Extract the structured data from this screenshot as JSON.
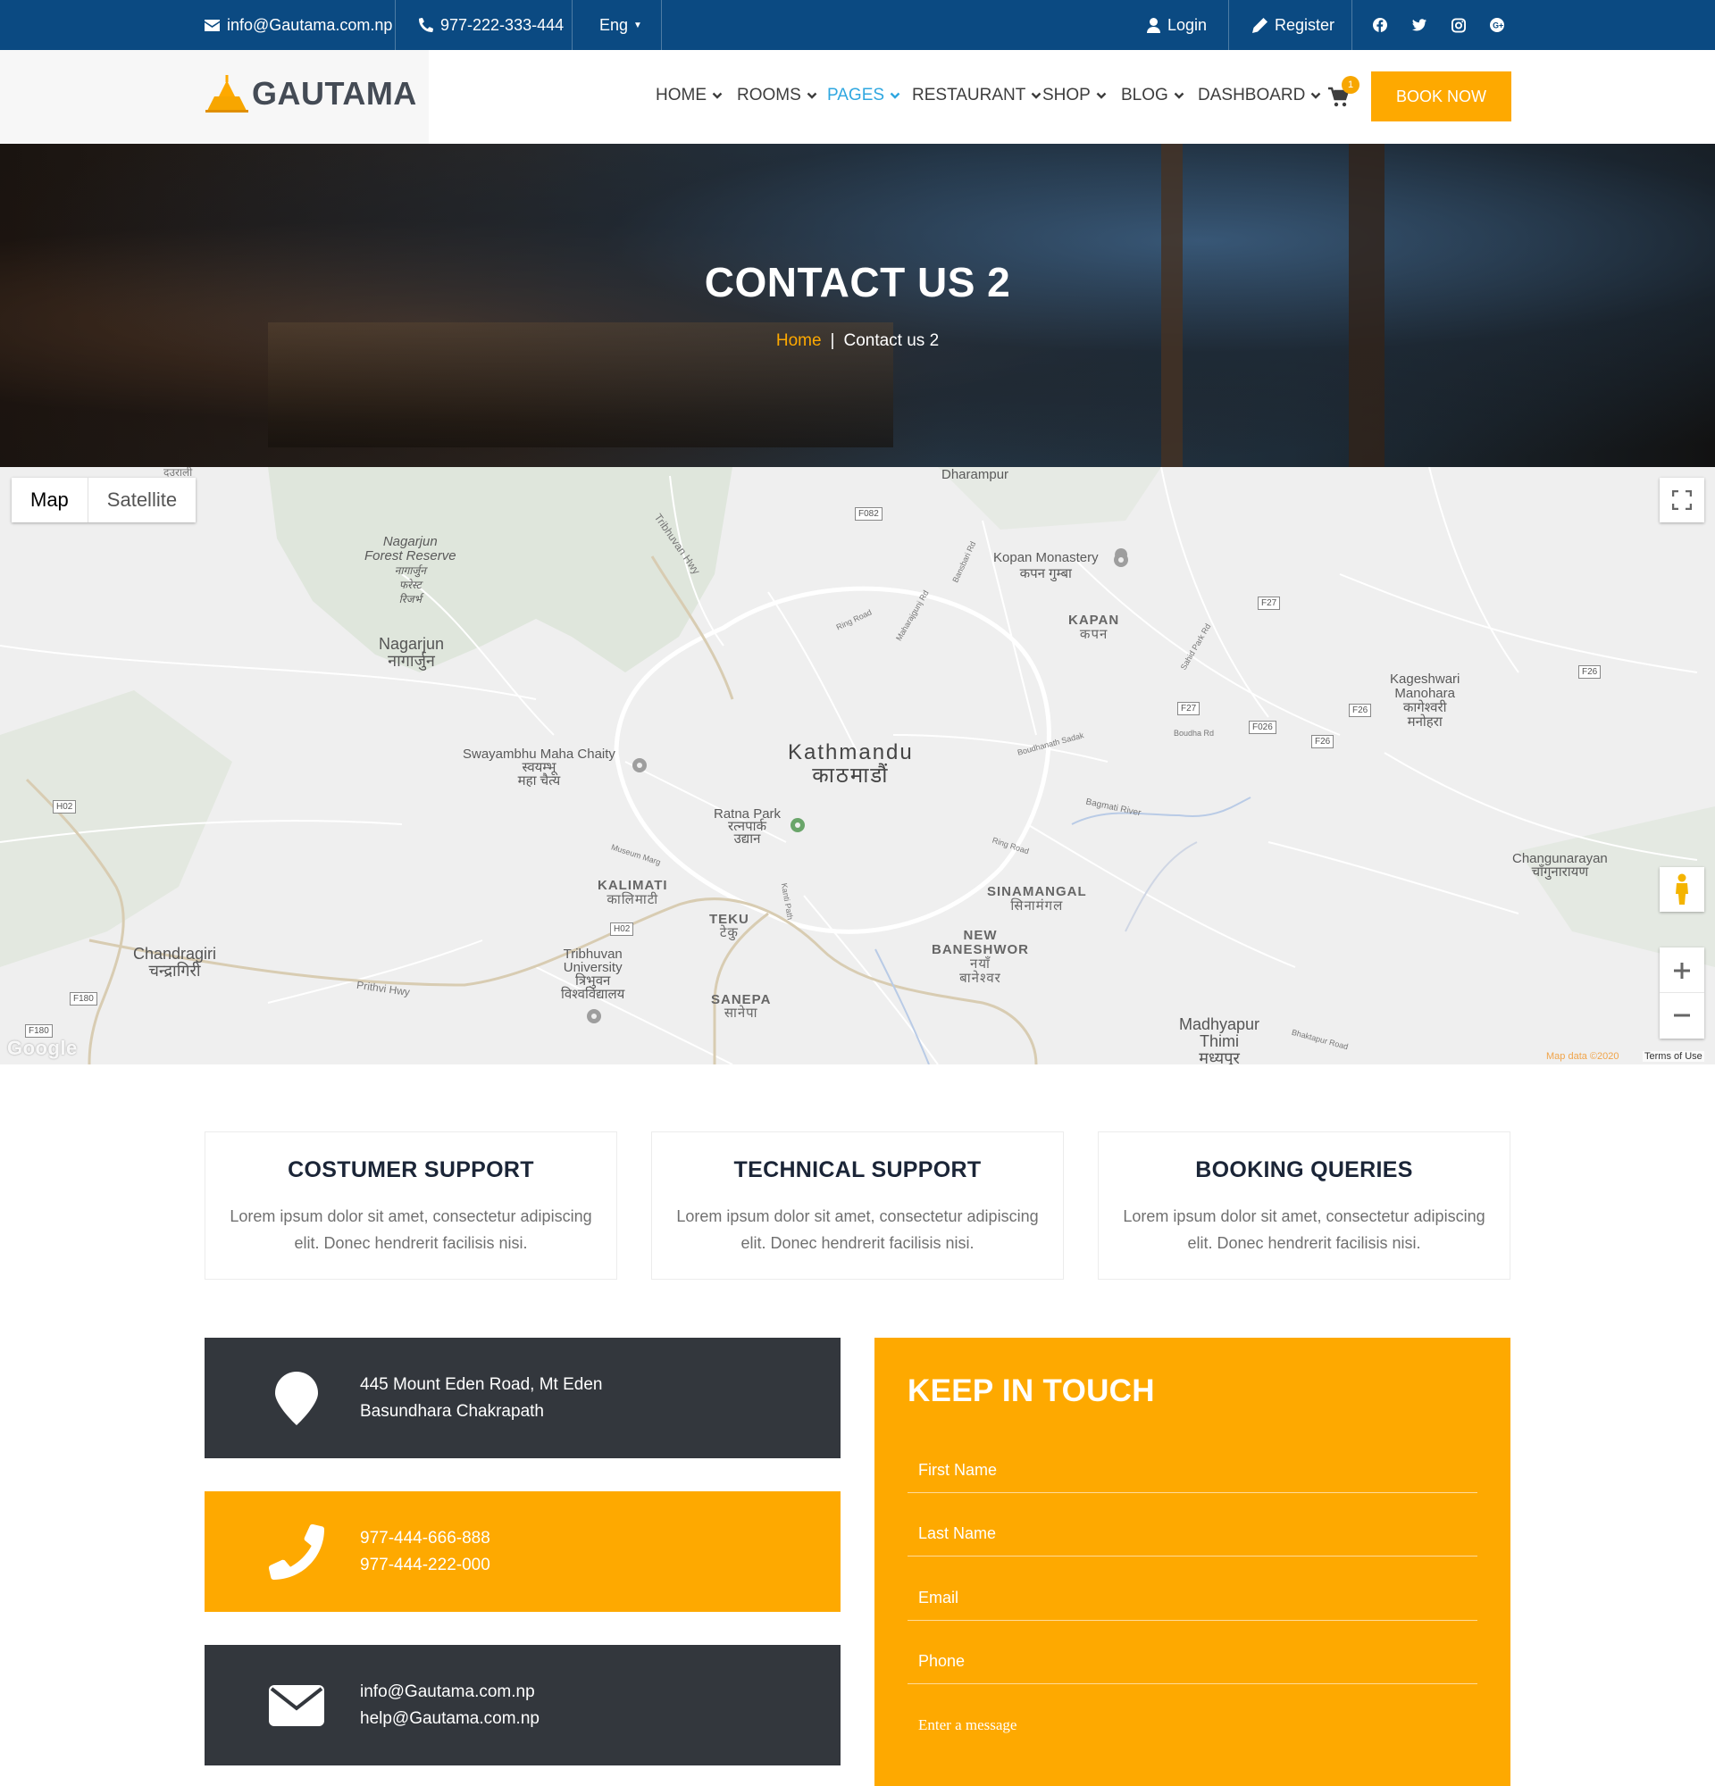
{
  "topbar": {
    "email": "info@Gautama.com.np",
    "phone": "977-222-333-444",
    "language": "Eng",
    "login": "Login",
    "register": "Register",
    "social_icons": [
      "facebook-icon",
      "twitter-icon",
      "instagram-icon",
      "google-plus-icon"
    ]
  },
  "brand": {
    "name": "GAUTAMA",
    "accent": "#fea900",
    "primary": "#0b4a82"
  },
  "nav": {
    "items": [
      {
        "label": "HOME"
      },
      {
        "label": "ROOMS"
      },
      {
        "label": "PAGES",
        "active": true
      },
      {
        "label": "RESTAURANT"
      },
      {
        "label": "SHOP"
      },
      {
        "label": "BLOG"
      },
      {
        "label": "DASHBOARD"
      }
    ],
    "cart_count": "1",
    "book_now": "BOOK NOW"
  },
  "hero": {
    "title": "CONTACT US 2",
    "breadcrumb_home": "Home",
    "breadcrumb_sep": "|",
    "breadcrumb_current": "Contact us 2"
  },
  "map": {
    "type_map": "Map",
    "type_satellite": "Satellite",
    "google": "Google",
    "map_data": "Map data ©2020",
    "terms": "Terms of Use",
    "labels": {
      "dauralia": "दउराली",
      "dharampur": "Dharampur",
      "nagarjun_forest_1": "Nagarjun",
      "nagarjun_forest_2": "Forest Reserve",
      "nagarjun_forest_3": "नागार्जुन",
      "nagarjun_forest_4": "फरेस्ट",
      "nagarjun_forest_5": "रिजर्भ",
      "nagarjun_1": "Nagarjun",
      "nagarjun_2": "नागार्जुन",
      "tribhuvan_hwy": "Tribhuvan Hwy",
      "kopan_monastery_1": "Kopan Monastery",
      "kopan_monastery_2": "कपन गुम्बा",
      "kapan_1": "KAPAN",
      "kapan_2": "कपन",
      "kageshwari_1": "Kageshwari",
      "kageshwari_2": "Manohara",
      "kageshwari_3": "कागेश्वरी",
      "kageshwari_4": "मनोहरा",
      "swayambhu_1": "Swayambhu Maha Chaity",
      "swayambhu_2": "स्वयम्भू",
      "swayambhu_3": "महा चैत्य",
      "kathmandu_1": "Kathmandu",
      "kathmandu_2": "काठमाडौं",
      "ratna_park_1": "Ratna Park",
      "ratna_park_2": "रत्नपार्क",
      "ratna_park_3": "उद्यान",
      "kalimati_1": "KALIMATI",
      "kalimati_2": "कालिमाटी",
      "teku_1": "TEKU",
      "teku_2": "टेकु",
      "chandragiri_1": "Chandragiri",
      "chandragiri_2": "चन्द्रागिरी",
      "tribhuvan_univ_1": "Tribhuvan",
      "tribhuvan_univ_2": "University",
      "tribhuvan_univ_3": "त्रिभुवन",
      "tribhuvan_univ_4": "विश्वविद्यालय",
      "sanepa_1": "SANEPA",
      "sanepa_2": "सानेपा",
      "sinamangal_1": "SINAMANGAL",
      "sinamangal_2": "सिनामंगल",
      "new_baneshwor_1": "NEW",
      "new_baneshwor_2": "BANESHWOR",
      "new_baneshwor_3": "नयाँ",
      "new_baneshwor_4": "बानेश्वर",
      "changunarayan_1": "Changunarayan",
      "changunarayan_2": "चाँगुनारायण",
      "madhyapur_1": "Madhyapur",
      "madhyapur_2": "Thimi",
      "madhyapur_3": "मध्यपुर",
      "prithvi_hwy": "Prithvi Hwy",
      "ring_road": "Ring Road",
      "museum_marg": "Museum Marg",
      "boudha_rd": "Boudha Rd",
      "bagmati_river": "Bagmati River",
      "bhaktapur_road": "Bhaktapur Road",
      "kanti_path": "Kanti Path",
      "maharajgunj_rd": "Maharajgunj Rd",
      "bansbari_rd": "Bansbari Rd",
      "sahid_park_rd": "Sahid Park Rd",
      "boudhanath_sadak": "Boudhanath Sadak"
    },
    "road_tags": {
      "f082": "F082",
      "f27a": "F27",
      "f27b": "F27",
      "f26a": "F26",
      "f26b": "F26",
      "f26c": "F26",
      "f026": "F026",
      "h02a": "H02",
      "h02b": "H02",
      "f180a": "F180",
      "f180b": "F180"
    }
  },
  "support_cards": [
    {
      "title": "COSTUMER SUPPORT",
      "text": "Lorem ipsum dolor sit amet, consectetur adipiscing elit. Donec hendrerit facilisis nisi."
    },
    {
      "title": "TECHNICAL SUPPORT",
      "text": "Lorem ipsum dolor sit amet, consectetur adipiscing elit. Donec hendrerit facilisis nisi."
    },
    {
      "title": "BOOKING QUERIES",
      "text": "Lorem ipsum dolor sit amet, consectetur adipiscing elit. Donec hendrerit facilisis nisi."
    }
  ],
  "contact_info": {
    "address_line1": "445 Mount Eden Road, Mt Eden",
    "address_line2": "Basundhara Chakrapath",
    "phone1": "977-444-666-888",
    "phone2": "977-444-222-000",
    "email1": "info@Gautama.com.np",
    "email2": "help@Gautama.com.np"
  },
  "form": {
    "title": "KEEP IN TOUCH",
    "first_name": "First Name",
    "last_name": "Last Name",
    "email": "Email",
    "phone": "Phone",
    "message": "Enter a message"
  }
}
